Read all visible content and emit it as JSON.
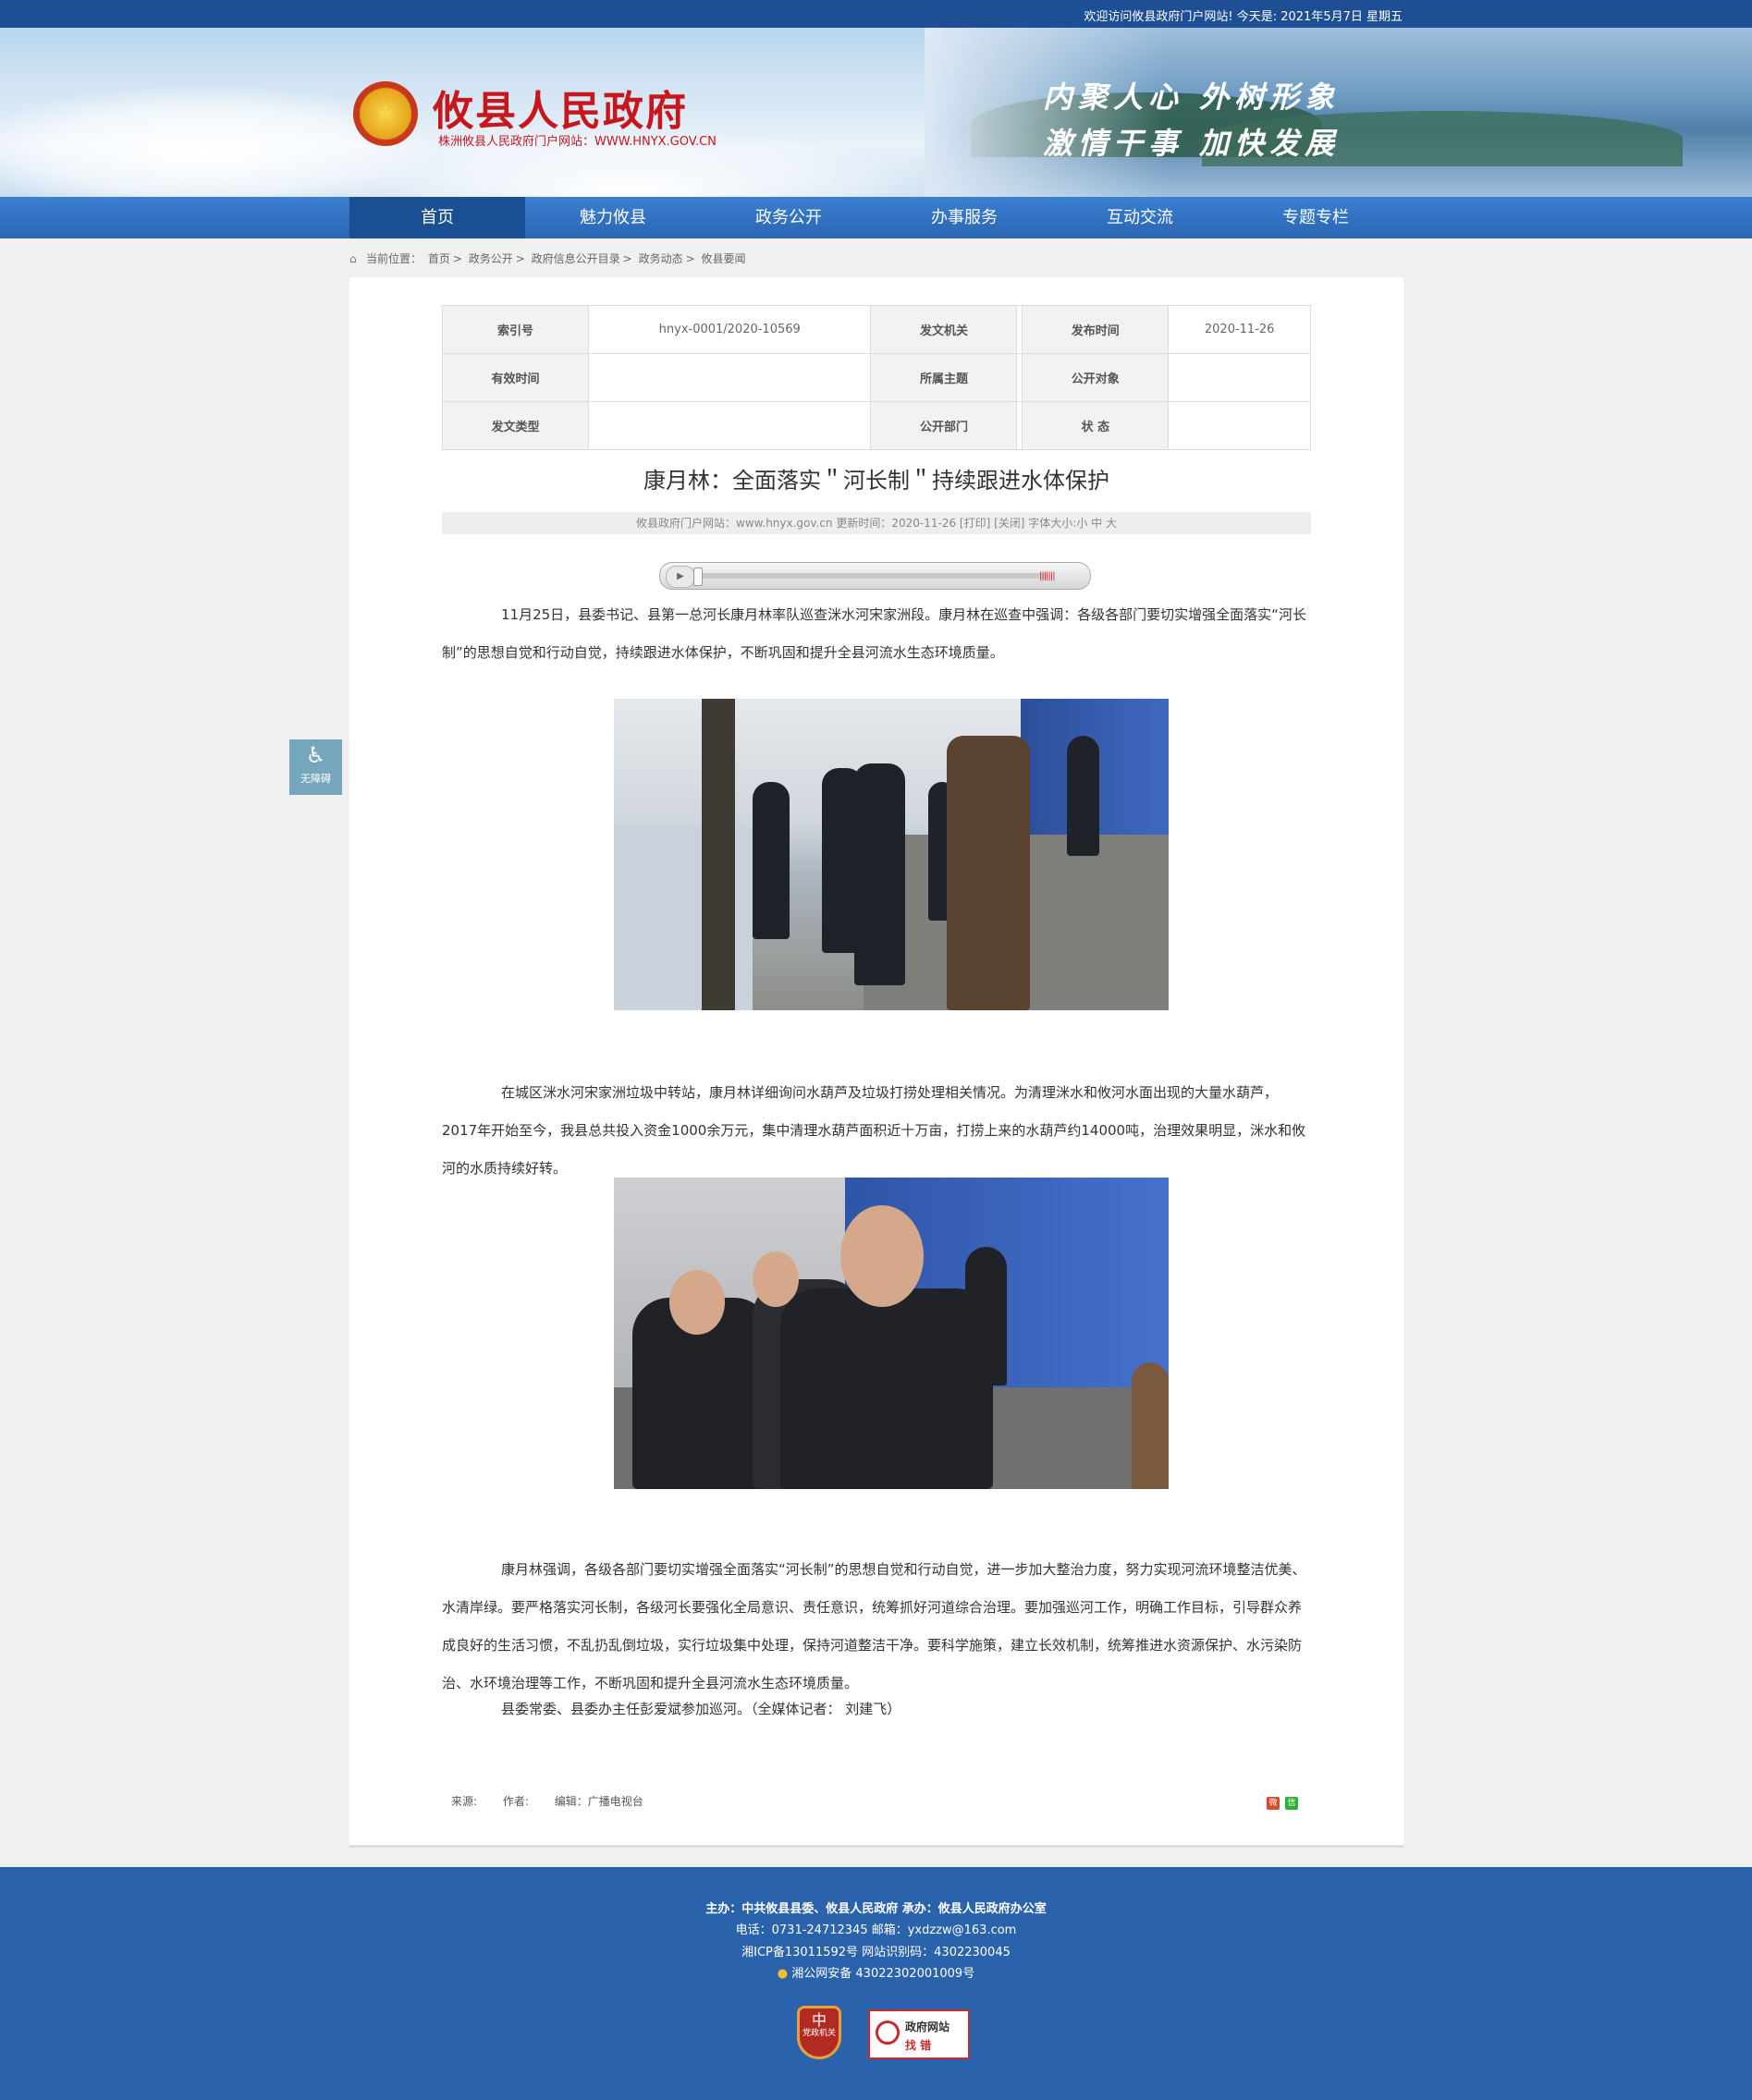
{
  "topbar": {
    "welcome": "欢迎访问攸县政府门户网站! 今天是: 2021年5月7日 星期五"
  },
  "header": {
    "title": "攸县人民政府",
    "subtitle": "株洲攸县人民政府门户网站：WWW.HNYX.GOV.CN",
    "slogan_line1": "内聚人心 外树形象",
    "slogan_line2": "激情干事 加快发展"
  },
  "nav": {
    "items": [
      "首页",
      "魅力攸县",
      "政务公开",
      "办事服务",
      "互动交流",
      "专题专栏"
    ]
  },
  "breadcrumb": {
    "prefix": "当前位置：",
    "items": [
      "首页",
      "政务公开",
      "政府信息公开目录",
      "政务动态",
      "攸县要闻"
    ],
    "sep": ">"
  },
  "meta": {
    "rows": [
      [
        {
          "label": "索引号",
          "value": "hnyx-0001/2020-10569"
        },
        {
          "label": "发文机关",
          "value": ""
        },
        {
          "label": "发布时间",
          "value": "2020-11-26"
        }
      ],
      [
        {
          "label": "有效时间",
          "value": ""
        },
        {
          "label": "所属主题",
          "value": ""
        },
        {
          "label": "公开对象",
          "value": ""
        }
      ],
      [
        {
          "label": "发文类型",
          "value": ""
        },
        {
          "label": "公开部门",
          "value": ""
        },
        {
          "label": "状 态",
          "value": ""
        }
      ]
    ]
  },
  "article": {
    "title": "康月林：全面落实＂河长制＂持续跟进水体保护",
    "info": "攸县政府门户网站：www.hnyx.gov.cn  更新时间：2020-11-26  [打印] [关闭]  字体大小:小 中 大",
    "paragraphs": [
      "11月25日，县委书记、县第一总河长康月林率队巡查洣水河宋家洲段。康月林在巡查中强调：各级各部门要切实增强全面落实“河长制”的思想自觉和行动自觉，持续跟进水体保护，不断巩固和提升全县河流水生态环境质量。",
      "在城区洣水河宋家洲垃圾中转站，康月林详细询问水葫芦及垃圾打捞处理相关情况。为清理洣水和攸河水面出现的大量水葫芦，2017年开始至今，我县总共投入资金1000余万元，集中清理水葫芦面积近十万亩，打捞上来的水葫芦约14000吨，治理效果明显，洣水和攸河的水质持续好转。",
      "康月林强调，各级各部门要切实增强全面落实“河长制”的思想自觉和行动自觉，进一步加大整治力度，努力实现河流环境整洁优美、水清岸绿。要严格落实河长制，各级河长要强化全局意识、责任意识，统筹抓好河道综合治理。要加强巡河工作，明确工作目标，引导群众养成良好的生活习惯，不乱扔乱倒垃圾，实行垃圾集中处理，保持河道整洁干净。要科学施策，建立长效机制，统筹推进水资源保护、水污染防治、水环境治理等工作，不断巩固和提升全县河流水生态环境质量。",
      "县委常委、县委办主任彭爱斌参加巡河。（全媒体记者：  刘建飞）"
    ],
    "source_label": "来源:",
    "author_label": "作者:",
    "editor": "编辑：广播电视台"
  },
  "a11y": {
    "label": "无障碍"
  },
  "footer": {
    "line1": "主办：中共攸县县委、攸县人民政府 承办：攸县人民政府办公室",
    "line2": "电话：0731-24712345 邮箱：yxdzzw@163.com",
    "line3": "湘ICP备13011592号   网站识别码：4302230045",
    "line4": "湘公网安备 43022302001009号",
    "badge1": "党政机关",
    "badge2_top": "政府网站",
    "badge2_bottom": "找 错"
  },
  "colors": {
    "nav": "#2a66b4",
    "nav_active": "#1a4f93",
    "footer": "#2a63ab",
    "title_red": "#c8161d"
  }
}
